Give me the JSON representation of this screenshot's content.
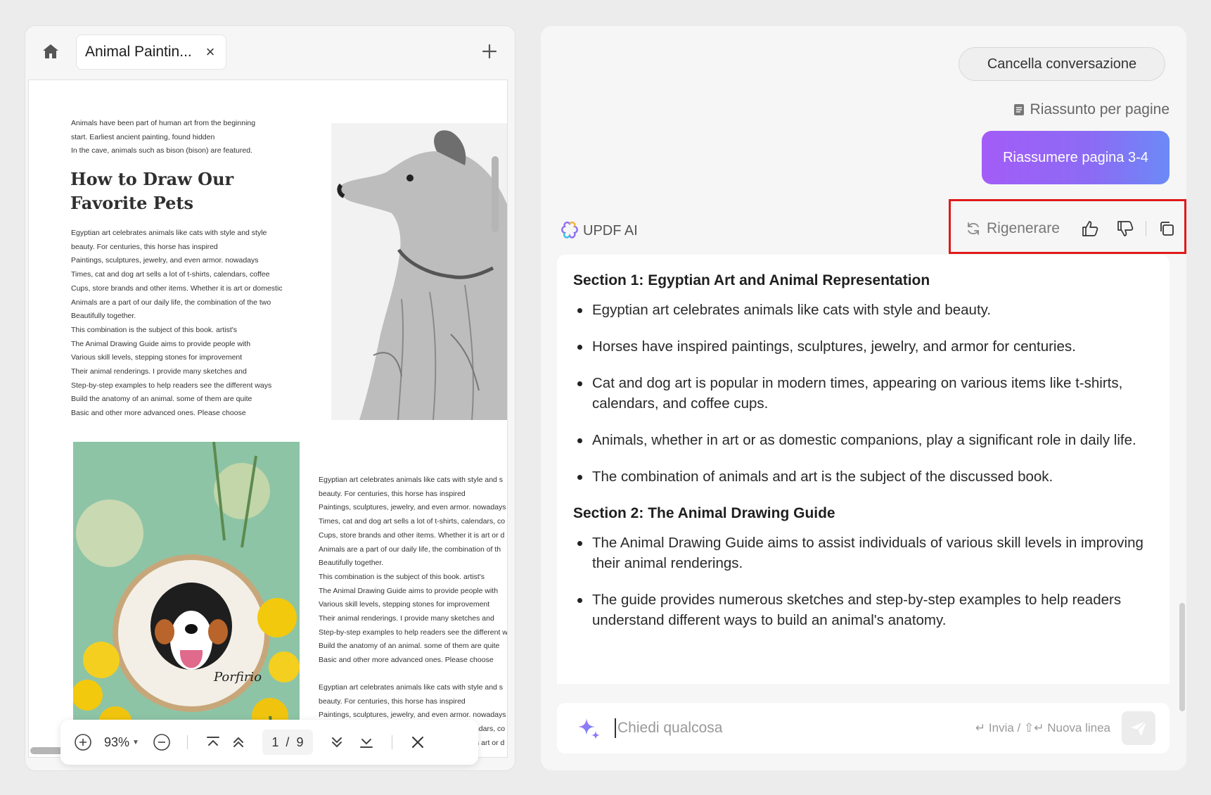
{
  "left_panel": {
    "tab_title": "Animal Paintin...",
    "document": {
      "intro_lines": [
        "Animals have been part of human art from the beginning",
        "start. Earliest ancient painting, found hidden",
        "In the cave, animals such as bison (bison) are featured."
      ],
      "heading": "How to Draw Our Favorite Pets",
      "body_lines": [
        "Egyptian art celebrates animals like cats with style and style",
        "beauty. For centuries, this horse has inspired",
        "Paintings, sculptures, jewelry, and even armor. nowadays",
        "Times, cat and dog art sells a lot of t-shirts, calendars, coffee",
        "Cups, store brands and other items. Whether it is art or domestic",
        "Animals are a part of our daily life, the combination of the two",
        "Beautifully together.",
        "This combination is the subject of this book. artist's",
        "The Animal Drawing Guide aims to provide people with",
        "Various skill levels, stepping stones for improvement",
        "Their animal renderings. I provide many sketches and",
        "Step-by-step examples to help readers see the different ways",
        "Build the anatomy of an animal. some of them are quite",
        "Basic and other more advanced ones. Please choose"
      ],
      "body2_lines": [
        "Egyptian art celebrates animals like cats with style and s",
        "beauty. For centuries, this horse has inspired",
        "Paintings, sculptures, jewelry, and even armor. nowadays",
        "Times, cat and dog art sells a lot of t-shirts, calendars, co",
        "Cups, store brands and other items. Whether it is art or d",
        "Animals are a part of our daily life, the combination of th",
        "Beautifully together.",
        "This combination is the subject of this book. artist's",
        "The Animal Drawing Guide aims to provide people with",
        "Various skill levels, stepping stones for improvement",
        "Their animal renderings. I provide many sketches and",
        "Step-by-step examples to help readers see the different w",
        "Build the anatomy of an animal. some of them are quite",
        "Basic and other more advanced ones. Please choose"
      ],
      "body3_lines": [
        "Egyptian art celebrates animals like cats with style and s",
        "beauty. For centuries, this horse has inspired",
        "Paintings, sculptures, jewelry, and even armor. nowadays",
        "Times, cat and dog art sells a lot of t-shirts, calendars, co",
        "Cups, store brands and other items. Whether it is art or d"
      ],
      "photo_signature": "Porfirio"
    },
    "toolbar": {
      "zoom": "93%",
      "current_page": "1",
      "page_separator": "/",
      "total_pages": "9"
    }
  },
  "right_panel": {
    "clear_button": "Cancella conversazione",
    "summary_chip": "Riassunto per pagine",
    "user_message": "Riassumere pagina 3-4",
    "ai_name": "UPDF AI",
    "regenerate_label": "Rigenerare",
    "answer": {
      "sections": [
        {
          "title": "Section 1: Egyptian Art and Animal Representation",
          "bullets": [
            "Egyptian art celebrates animals like cats with style and beauty.",
            "Horses have inspired paintings, sculptures, jewelry, and armor for centuries.",
            "Cat and dog art is popular in modern times, appearing on various items like t-shirts, calendars, and coffee cups.",
            "Animals, whether in art or as domestic companions, play a significant role in daily life.",
            "The combination of animals and art is the subject of the discussed book."
          ]
        },
        {
          "title": "Section 2: The Animal Drawing Guide",
          "bullets": [
            "The Animal Drawing Guide aims to assist individuals of various skill levels in improving their animal renderings.",
            "The guide provides numerous sketches and step-by-step examples to help readers understand different ways to build an animal's anatomy."
          ]
        }
      ]
    },
    "input": {
      "placeholder": "Chiedi qualcosa",
      "hint_send": "Invia",
      "hint_sep": "/",
      "hint_newline": "Nuova linea"
    }
  },
  "colors": {
    "highlight_border": "#e01a1a",
    "user_bubble_start": "#a35cf7",
    "user_bubble_end": "#6b8af6"
  }
}
